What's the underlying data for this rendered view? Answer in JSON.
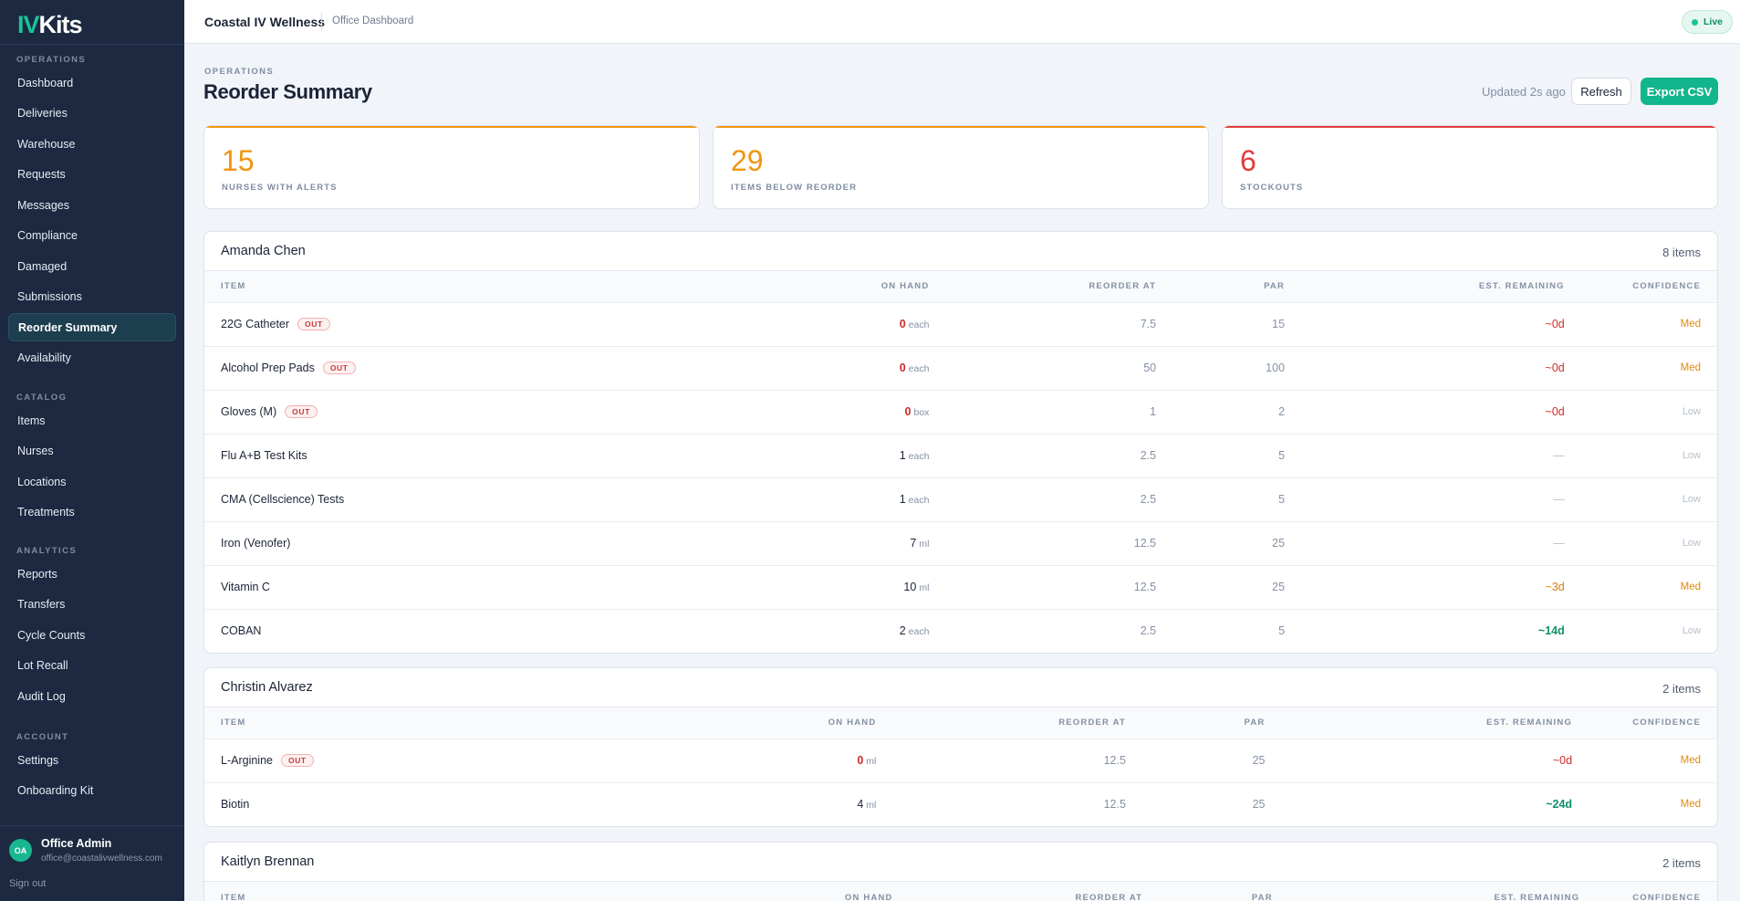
{
  "brand": {
    "logo_iv": "IV",
    "logo_kits": "Kits"
  },
  "sidebar": {
    "sections": [
      {
        "label": "OPERATIONS",
        "items": [
          "Dashboard",
          "Deliveries",
          "Warehouse",
          "Requests",
          "Messages",
          "Compliance",
          "Damaged",
          "Submissions",
          "Reorder Summary",
          "Availability"
        ]
      },
      {
        "label": "CATALOG",
        "items": [
          "Items",
          "Nurses",
          "Locations",
          "Treatments"
        ]
      },
      {
        "label": "ANALYTICS",
        "items": [
          "Reports",
          "Transfers",
          "Cycle Counts",
          "Lot Recall",
          "Audit Log"
        ]
      },
      {
        "label": "ACCOUNT",
        "items": [
          "Settings",
          "Onboarding Kit"
        ]
      }
    ],
    "active_item": "Reorder Summary",
    "user": {
      "initials": "OA",
      "name": "Office Admin",
      "email": "office@coastalivwellness.com"
    },
    "sign_out": "Sign out"
  },
  "topbar": {
    "org": "Coastal IV Wellness",
    "subtitle": "Office Dashboard",
    "live": "Live"
  },
  "header": {
    "eyebrow": "OPERATIONS",
    "title": "Reorder Summary",
    "updated": "Updated 2s ago",
    "refresh": "Refresh",
    "export": "Export CSV"
  },
  "stats": [
    {
      "value": "15",
      "label": "NURSES WITH ALERTS",
      "color": "#f0960f"
    },
    {
      "value": "29",
      "label": "ITEMS BELOW REORDER",
      "color": "#f0960f"
    },
    {
      "value": "6",
      "label": "STOCKOUTS",
      "color": "#e23b3b"
    }
  ],
  "columns": [
    "ITEM",
    "ON HAND",
    "REORDER AT",
    "PAR",
    "EST. REMAINING",
    "CONFIDENCE"
  ],
  "out_label": "OUT",
  "groups": [
    {
      "name": "Amanda Chen",
      "count": "8 items",
      "rows": [
        {
          "item": "22G Catheter",
          "out": true,
          "on_hand": "0",
          "unit": "each",
          "reorder": "7.5",
          "par": "15",
          "remaining": "~0d",
          "rem_style": "red",
          "confidence": "Med"
        },
        {
          "item": "Alcohol Prep Pads",
          "out": true,
          "on_hand": "0",
          "unit": "each",
          "reorder": "50",
          "par": "100",
          "remaining": "~0d",
          "rem_style": "red",
          "confidence": "Med"
        },
        {
          "item": "Gloves (M)",
          "out": true,
          "on_hand": "0",
          "unit": "box",
          "reorder": "1",
          "par": "2",
          "remaining": "~0d",
          "rem_style": "red",
          "confidence": "Low"
        },
        {
          "item": "Flu A+B Test Kits",
          "out": false,
          "on_hand": "1",
          "unit": "each",
          "reorder": "2.5",
          "par": "5",
          "remaining": "—",
          "rem_style": "dash",
          "confidence": "Low"
        },
        {
          "item": "CMA (Cellscience) Tests",
          "out": false,
          "on_hand": "1",
          "unit": "each",
          "reorder": "2.5",
          "par": "5",
          "remaining": "—",
          "rem_style": "dash",
          "confidence": "Low"
        },
        {
          "item": "Iron (Venofer)",
          "out": false,
          "on_hand": "7",
          "unit": "ml",
          "reorder": "12.5",
          "par": "25",
          "remaining": "—",
          "rem_style": "dash",
          "confidence": "Low"
        },
        {
          "item": "Vitamin C",
          "out": false,
          "on_hand": "10",
          "unit": "ml",
          "reorder": "12.5",
          "par": "25",
          "remaining": "~3d",
          "rem_style": "orange",
          "confidence": "Med"
        },
        {
          "item": "COBAN",
          "out": false,
          "on_hand": "2",
          "unit": "each",
          "reorder": "2.5",
          "par": "5",
          "remaining": "~14d",
          "rem_style": "green",
          "confidence": "Low"
        }
      ]
    },
    {
      "name": "Christin Alvarez",
      "count": "2 items",
      "rows": [
        {
          "item": "L-Arginine",
          "out": true,
          "on_hand": "0",
          "unit": "ml",
          "reorder": "12.5",
          "par": "25",
          "remaining": "~0d",
          "rem_style": "red",
          "confidence": "Med"
        },
        {
          "item": "Biotin",
          "out": false,
          "on_hand": "4",
          "unit": "ml",
          "reorder": "12.5",
          "par": "25",
          "remaining": "~24d",
          "rem_style": "green",
          "confidence": "Med"
        }
      ]
    },
    {
      "name": "Kaitlyn Brennan",
      "count": "2 items",
      "rows": []
    }
  ]
}
